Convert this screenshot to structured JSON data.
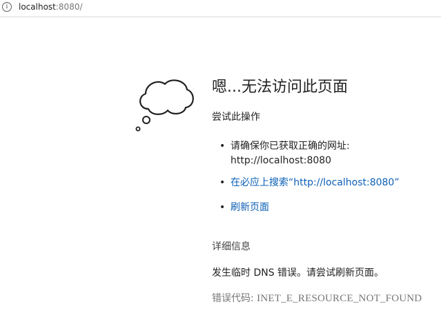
{
  "address_bar": {
    "host": "localhost",
    "rest": ":8080/"
  },
  "main": {
    "title": "嗯...无法访问此页面",
    "subtitle": "尝试此操作",
    "suggestions": [
      {
        "line1": "请确保你已获取正确的网址:",
        "line2": "http://localhost:8080"
      },
      {
        "label": "在必应上搜索“http://localhost:8080”"
      },
      {
        "label": "刷新页面"
      }
    ],
    "details_heading": "详细信息",
    "dns_message": "发生临时 DNS 错误。请尝试刷新页面。",
    "error_code_label": "错误代码: ",
    "error_code": "INET_E_RESOURCE_NOT_FOUND"
  },
  "colors": {
    "link": "#0b5fb5",
    "text": "#1f1f1f",
    "muted": "#767676"
  }
}
